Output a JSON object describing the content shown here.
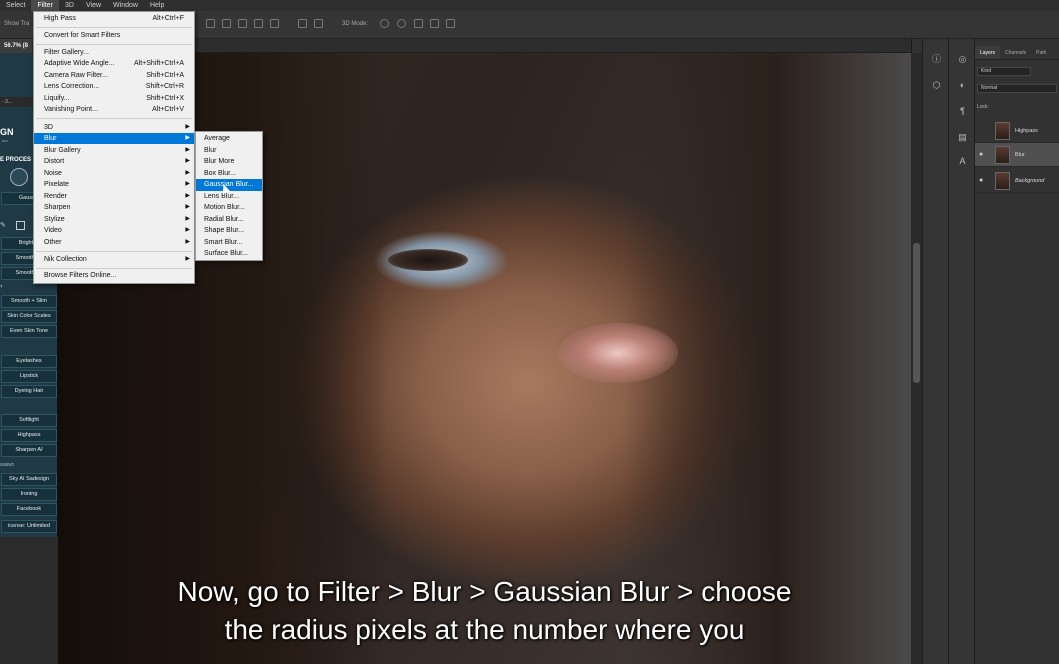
{
  "menubar": {
    "items": [
      "Select",
      "Filter",
      "3D",
      "View",
      "Window",
      "Help"
    ],
    "active": "Filter"
  },
  "optionsbar": {
    "show_transform": "Show Tra",
    "mode_3d": "3D Mode:"
  },
  "doc": {
    "tab_label": "56.7% (8"
  },
  "left_panel": {
    "tab": "- 3...",
    "logo": "GN",
    "logo_sub": "EMY",
    "process_title": "E PROCES",
    "current": "Gaussia",
    "buttons": [
      {
        "label": "Brighten"
      },
      {
        "label": "Smooth Sk"
      },
      {
        "label": "Smooth Sk"
      },
      {
        "label": "Smooth + Slim"
      },
      {
        "label": "Skin Color Scales"
      },
      {
        "label": "Even Skin Tone"
      },
      {
        "label": "Eyelashes"
      },
      {
        "label": "Lipstick"
      },
      {
        "label": "Dyeing Hair"
      },
      {
        "label": "Softlight"
      },
      {
        "label": "Highpass"
      },
      {
        "label": "Sharpen AI"
      },
      {
        "label": "Sky AI Sadesign"
      },
      {
        "label": "Ironing"
      },
      {
        "label": "Facebook"
      },
      {
        "label": "icense: Unlimited"
      }
    ],
    "section_t": "T",
    "section_sing": "SSING"
  },
  "filter_menu": {
    "items": [
      {
        "label": "High Pass",
        "shortcut": "Alt+Ctrl+F"
      },
      {
        "label": "Convert for Smart Filters",
        "shortcut": ""
      },
      {
        "label": "Filter Gallery...",
        "shortcut": ""
      },
      {
        "label": "Adaptive Wide Angle...",
        "shortcut": "Alt+Shift+Ctrl+A"
      },
      {
        "label": "Camera Raw Filter...",
        "shortcut": "Shift+Ctrl+A"
      },
      {
        "label": "Lens Correction...",
        "shortcut": "Shift+Ctrl+R"
      },
      {
        "label": "Liquify...",
        "shortcut": "Shift+Ctrl+X"
      },
      {
        "label": "Vanishing Point...",
        "shortcut": "Alt+Ctrl+V"
      },
      {
        "label": "3D",
        "shortcut": ""
      },
      {
        "label": "Blur",
        "shortcut": ""
      },
      {
        "label": "Blur Gallery",
        "shortcut": ""
      },
      {
        "label": "Distort",
        "shortcut": ""
      },
      {
        "label": "Noise",
        "shortcut": ""
      },
      {
        "label": "Pixelate",
        "shortcut": ""
      },
      {
        "label": "Render",
        "shortcut": ""
      },
      {
        "label": "Sharpen",
        "shortcut": ""
      },
      {
        "label": "Stylize",
        "shortcut": ""
      },
      {
        "label": "Video",
        "shortcut": ""
      },
      {
        "label": "Other",
        "shortcut": ""
      },
      {
        "label": "Nik Collection",
        "shortcut": ""
      },
      {
        "label": "Browse Filters Online...",
        "shortcut": ""
      }
    ],
    "highlighted": "Blur"
  },
  "blur_menu": {
    "items": [
      "Average",
      "Blur",
      "Blur More",
      "Box Blur...",
      "Gaussian Blur...",
      "Lens Blur...",
      "Motion Blur...",
      "Radial Blur...",
      "Shape Blur...",
      "Smart Blur...",
      "Surface Blur..."
    ],
    "highlighted": "Gaussian Blur..."
  },
  "layers_panel": {
    "tabs": [
      "Layers",
      "Channels",
      "Path"
    ],
    "kind": "Kind",
    "blend_mode": "Normal",
    "lock_label": "Lock:",
    "layers": [
      {
        "name": "Highpass",
        "visible": false,
        "selected": false
      },
      {
        "name": "Blur",
        "visible": true,
        "selected": true
      },
      {
        "name": "Background",
        "visible": true,
        "selected": false
      }
    ]
  },
  "caption": {
    "line1": "Now, go to Filter > Blur > Gaussian Blur > choose",
    "line2": "the radius pixels at the number where you"
  },
  "colors": {
    "menu_highlight": "#0078d7",
    "plugin_panel": "#1f3a45"
  }
}
